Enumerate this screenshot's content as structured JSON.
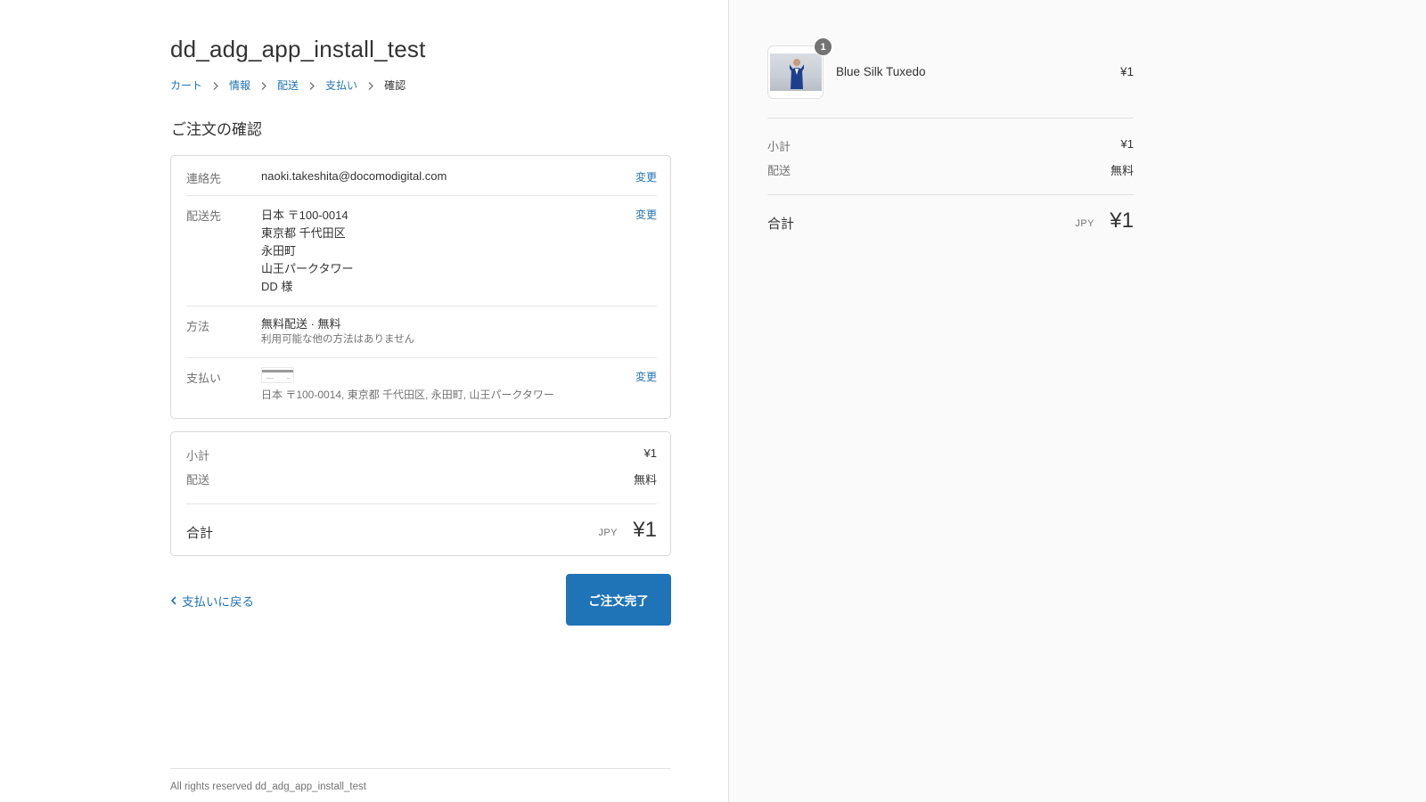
{
  "shop": {
    "title": "dd_adg_app_install_test"
  },
  "breadcrumb": {
    "cart": "カート",
    "information": "情報",
    "shipping": "配送",
    "payment": "支払い",
    "review": "確認"
  },
  "review": {
    "section_title": "ご注文の確認",
    "contact": {
      "label": "連絡先",
      "value": "naoki.takeshita@docomodigital.com",
      "change": "変更"
    },
    "ship_to": {
      "label": "配送先",
      "lines": [
        "日本 〒100-0014",
        "東京都 千代田区",
        "永田町",
        "山王パークタワー",
        "DD 様"
      ],
      "change": "変更"
    },
    "method": {
      "label": "方法",
      "value": "無料配送 · 無料",
      "note": "利用可能な他の方法はありません"
    },
    "payment": {
      "label": "支払い",
      "billing_address": "日本 〒100-0014, 東京都 千代田区, 永田町, 山王パークタワー",
      "change": "変更"
    }
  },
  "totals": {
    "subtotal_label": "小計",
    "subtotal_value": "¥1",
    "shipping_label": "配送",
    "shipping_value": "無料",
    "total_label": "合計",
    "currency": "JPY",
    "total_value": "¥1"
  },
  "actions": {
    "back_label": "支払いに戻る",
    "complete_label": "ご注文完了"
  },
  "footer": {
    "text": "All rights reserved dd_adg_app_install_test"
  },
  "sidebar": {
    "product": {
      "name": "Blue Silk Tuxedo",
      "price": "¥1",
      "quantity": "1"
    },
    "subtotal_label": "小計",
    "subtotal_value": "¥1",
    "shipping_label": "配送",
    "shipping_value": "無料",
    "total_label": "合計",
    "currency": "JPY",
    "total_value": "¥1"
  },
  "colors": {
    "accent": "#1f73b7",
    "sidebar_bg": "#fafafa",
    "text": "#333333",
    "muted": "#737373"
  }
}
